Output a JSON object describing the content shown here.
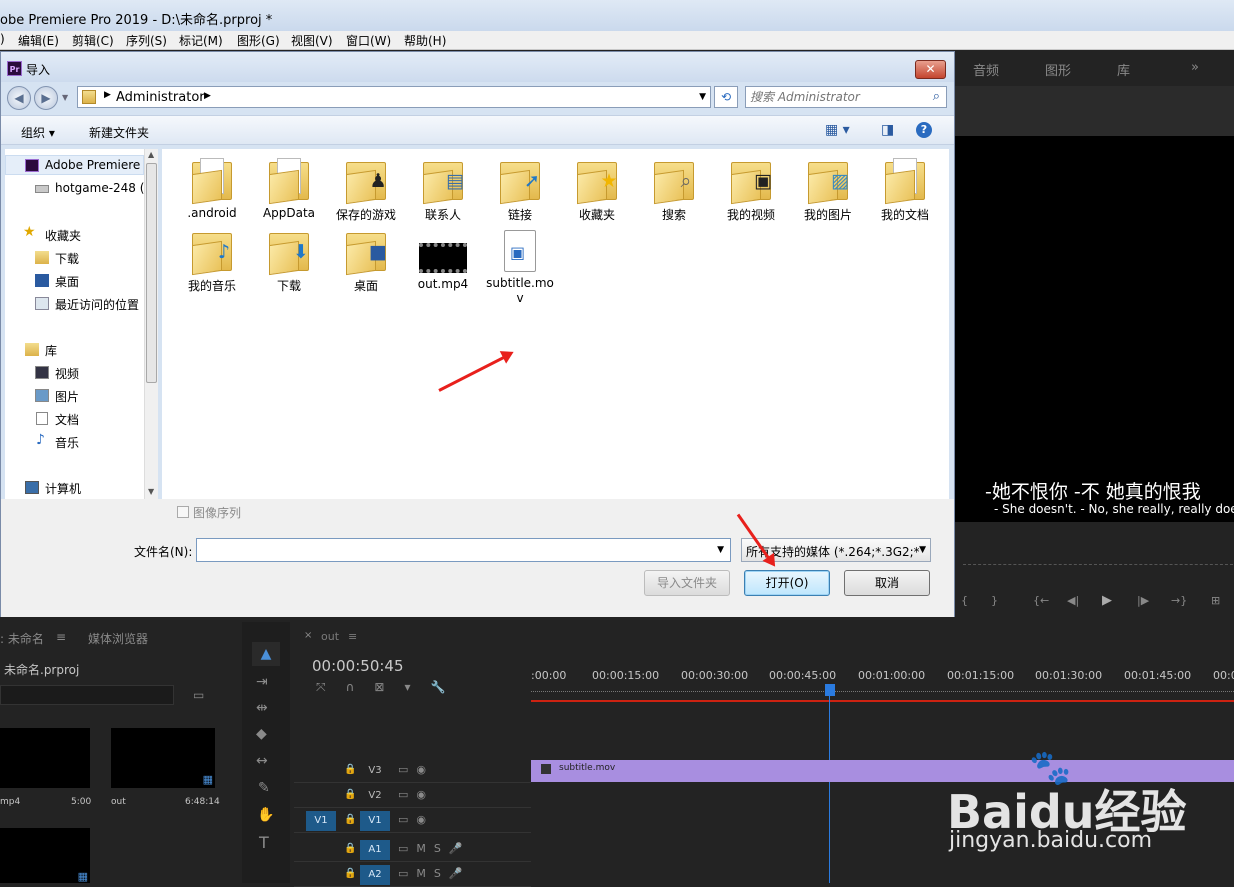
{
  "app": {
    "window_title": "obe Premiere Pro 2019 - D:\\未命名.prproj *",
    "menus": [
      ")",
      "编辑(E)",
      "剪辑(C)",
      "序列(S)",
      "标记(M)",
      "图形(G)",
      "视图(V)",
      "窗口(W)",
      "帮助(H)"
    ]
  },
  "program_panel": {
    "tabs": [
      "音频",
      "图形",
      "库",
      "»"
    ],
    "subtitle_cn": "-她不恨你  -不  她真的恨我",
    "subtitle_en": "- She doesn't. - No, she really, really does."
  },
  "dialog": {
    "title": "导入",
    "close": "✕",
    "address_path": "Administrator",
    "search_placeholder": "搜索 Administrator",
    "toolbar": {
      "organize": "组织 ▾",
      "new_folder": "新建文件夹"
    },
    "nav_items": [
      {
        "label": "Adobe Premiere",
        "icon": "premiere-icon"
      },
      {
        "label": "hotgame-248 (",
        "icon": "drive-icon"
      },
      {
        "label": "收藏夹",
        "icon": "star-icon"
      },
      {
        "label": "下载",
        "icon": "download-folder-icon"
      },
      {
        "label": "桌面",
        "icon": "desktop-icon"
      },
      {
        "label": "最近访问的位置",
        "icon": "recent-places-icon"
      },
      {
        "label": "库",
        "icon": "library-icon"
      },
      {
        "label": "视频",
        "icon": "video-library-icon"
      },
      {
        "label": "图片",
        "icon": "pictures-library-icon"
      },
      {
        "label": "文档",
        "icon": "documents-library-icon"
      },
      {
        "label": "音乐",
        "icon": "music-library-icon"
      },
      {
        "label": "计算机",
        "icon": "computer-icon"
      }
    ],
    "files": [
      {
        "label": ".android",
        "icon": "folder-icon"
      },
      {
        "label": "AppData",
        "icon": "folder-icon"
      },
      {
        "label": "保存的游戏",
        "icon": "saved-games-folder-icon"
      },
      {
        "label": "联系人",
        "icon": "contacts-folder-icon"
      },
      {
        "label": "链接",
        "icon": "links-folder-icon"
      },
      {
        "label": "收藏夹",
        "icon": "favorites-folder-icon"
      },
      {
        "label": "搜索",
        "icon": "searches-folder-icon"
      },
      {
        "label": "我的视频",
        "icon": "my-videos-folder-icon"
      },
      {
        "label": "我的图片",
        "icon": "my-pictures-folder-icon"
      },
      {
        "label": "我的文档",
        "icon": "my-documents-folder-icon"
      },
      {
        "label": "我的音乐",
        "icon": "my-music-folder-icon"
      },
      {
        "label": "下载",
        "icon": "downloads-folder-icon"
      },
      {
        "label": "桌面",
        "icon": "desktop-folder-icon"
      },
      {
        "label": "out.mp4",
        "icon": "video-file-icon"
      },
      {
        "label": "subtitle.mov",
        "icon": "mov-file-icon"
      }
    ],
    "image_sequence": "图像序列",
    "filename_label": "文件名(N):",
    "filename_value": "",
    "file_type": "所有支持的媒体 (*.264;*.3G2;*",
    "btn_import_folder": "导入文件夹",
    "btn_open": "打开(O)",
    "btn_cancel": "取消"
  },
  "project_panel": {
    "tab1": ": 未命名",
    "tab2": "媒体浏览器",
    "project_name": "未命名.prproj",
    "items": [
      {
        "name": "mp4",
        "duration": "5:00"
      },
      {
        "name": "out",
        "duration": "6:48:14"
      }
    ]
  },
  "timeline": {
    "tab": "out",
    "timecode": "00:00:50:45",
    "ruler": [
      ":00:00",
      "00:00:15:00",
      "00:00:30:00",
      "00:00:45:00",
      "00:01:00:00",
      "00:01:15:00",
      "00:01:30:00",
      "00:01:45:00",
      "00:0"
    ],
    "tracks": [
      "V3",
      "V2",
      "V1",
      "A1",
      "A2"
    ],
    "source_v": "V1",
    "clip_name": "subtitle.mov"
  },
  "watermark": {
    "text": "Baidu经验",
    "url": "jingyan.baidu.com"
  }
}
